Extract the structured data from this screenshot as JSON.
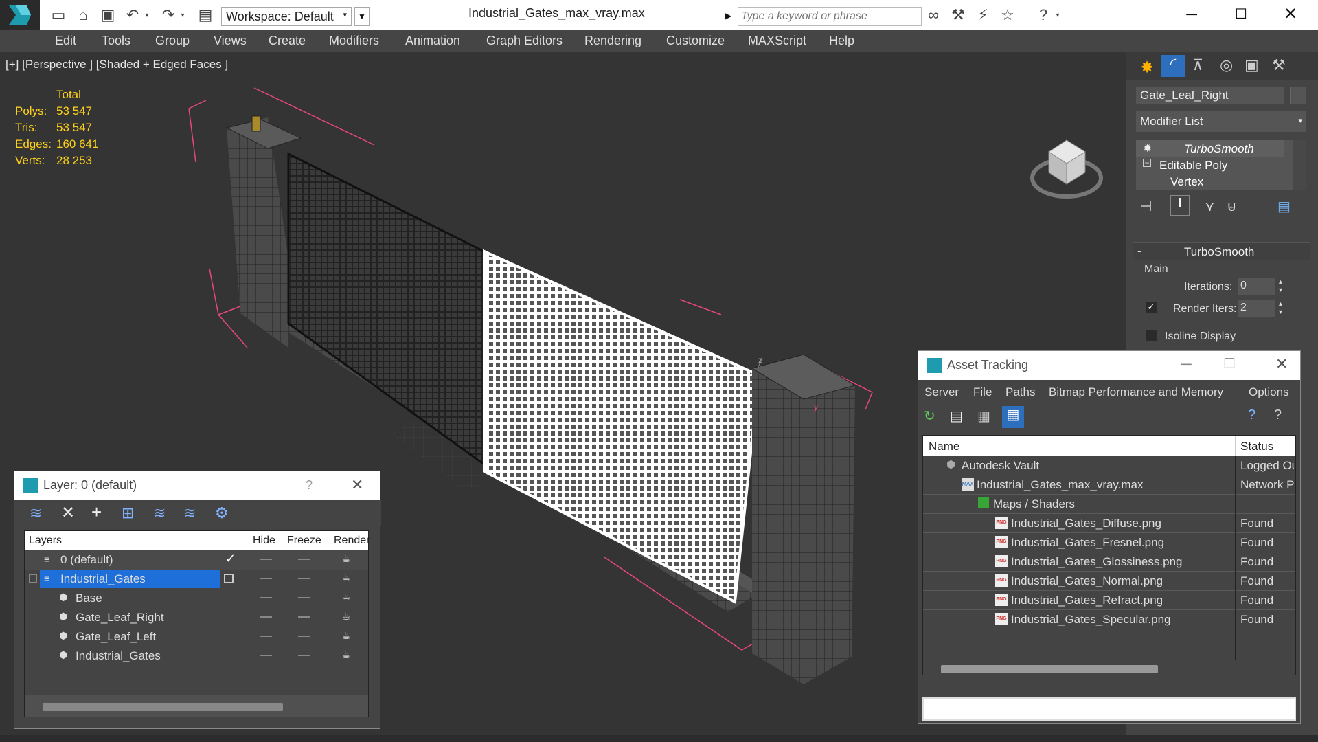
{
  "title": {
    "file": "Industrial_Gates_max_vray.max",
    "workspace": "Workspace: Default",
    "search_placeholder": "Type a keyword or phrase"
  },
  "menu": [
    "Edit",
    "Tools",
    "Group",
    "Views",
    "Create",
    "Modifiers",
    "Animation",
    "Graph Editors",
    "Rendering",
    "Customize",
    "MAXScript",
    "Help"
  ],
  "viewport": {
    "label": "[+] [Perspective ] [Shaded + Edged Faces ]",
    "stats": {
      "header": "Total",
      "rows": [
        {
          "label": "Polys:",
          "value": "53 547"
        },
        {
          "label": "Tris:",
          "value": "53 547"
        },
        {
          "label": "Edges:",
          "value": "160 641"
        },
        {
          "label": "Verts:",
          "value": "28 253"
        }
      ]
    },
    "axis_z": "z",
    "axis_y": "y"
  },
  "command_panel": {
    "object_name": "Gate_Leaf_Right",
    "modifier_list": "Modifier List",
    "stack": [
      "TurboSmooth",
      "Editable Poly",
      "Vertex"
    ],
    "rollout_title": "TurboSmooth",
    "group_main": "Main",
    "iterations_label": "Iterations:",
    "iterations_value": "0",
    "render_iters_label": "Render Iters:",
    "render_iters_value": "2",
    "isoline_label": "Isoline Display"
  },
  "layer_window": {
    "title": "Layer: 0 (default)",
    "help": "?",
    "columns": [
      "Layers",
      "Hide",
      "Freeze",
      "Render"
    ],
    "rows": [
      {
        "name": "0 (default)",
        "indent": 0
      },
      {
        "name": "Industrial_Gates",
        "indent": 0
      },
      {
        "name": "Base",
        "indent": 1
      },
      {
        "name": "Gate_Leaf_Right",
        "indent": 1
      },
      {
        "name": "Gate_Leaf_Left",
        "indent": 1
      },
      {
        "name": "Industrial_Gates",
        "indent": 1
      }
    ]
  },
  "asset_window": {
    "title": "Asset Tracking",
    "menu": [
      "Server",
      "File",
      "Paths",
      "Bitmap Performance and Memory",
      "Options"
    ],
    "columns": [
      "Name",
      "Status"
    ],
    "rows": [
      {
        "name": "Autodesk Vault",
        "status": "Logged Out",
        "indent": 0,
        "icon": "vault-icon"
      },
      {
        "name": "Industrial_Gates_max_vray.max",
        "status": "Network Path",
        "indent": 1,
        "icon": "max-file-icon"
      },
      {
        "name": "Maps / Shaders",
        "status": "",
        "indent": 2,
        "icon": "maps-folder-icon"
      },
      {
        "name": "Industrial_Gates_Diffuse.png",
        "status": "Found",
        "indent": 3,
        "icon": "png-icon"
      },
      {
        "name": "Industrial_Gates_Fresnel.png",
        "status": "Found",
        "indent": 3,
        "icon": "png-icon"
      },
      {
        "name": "Industrial_Gates_Glossiness.png",
        "status": "Found",
        "indent": 3,
        "icon": "png-icon"
      },
      {
        "name": "Industrial_Gates_Normal.png",
        "status": "Found",
        "indent": 3,
        "icon": "png-icon"
      },
      {
        "name": "Industrial_Gates_Refract.png",
        "status": "Found",
        "indent": 3,
        "icon": "png-icon"
      },
      {
        "name": "Industrial_Gates_Specular.png",
        "status": "Found",
        "indent": 3,
        "icon": "png-icon"
      }
    ]
  },
  "colors": {
    "accent": "#0a5aa8",
    "selection": "#1e6fd9",
    "stats": "#ffd21a",
    "bbox": "#e8487a"
  }
}
